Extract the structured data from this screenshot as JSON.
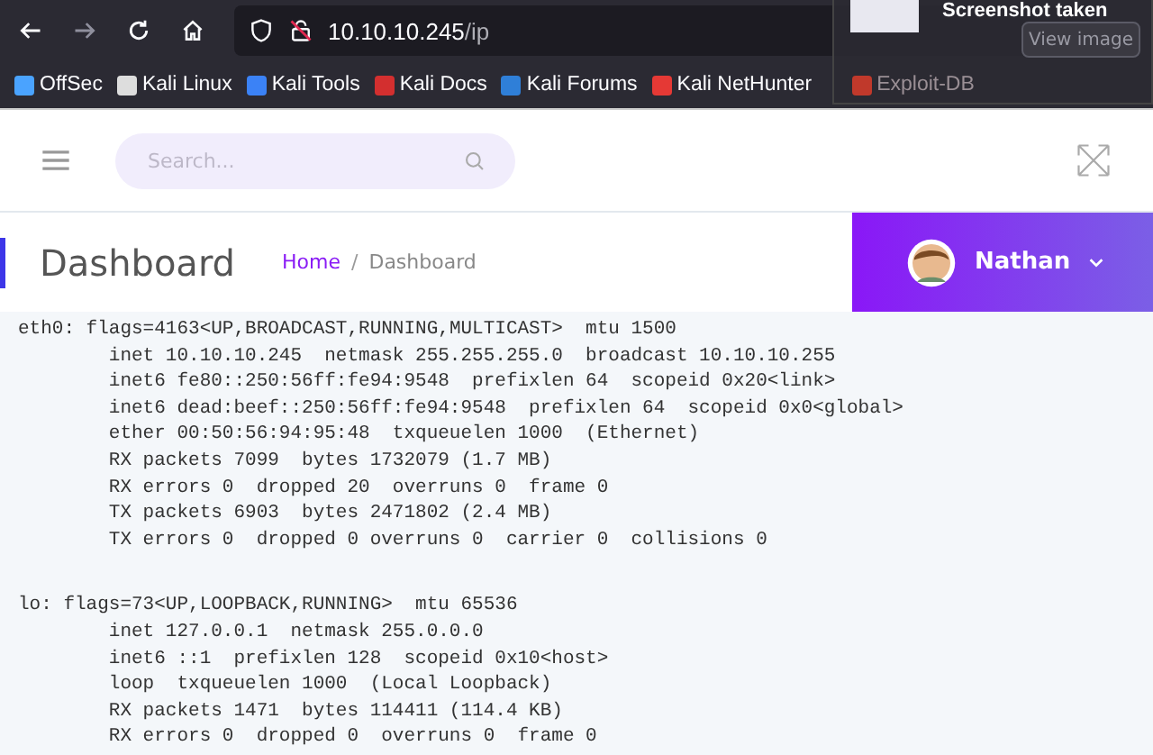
{
  "browser": {
    "address": {
      "host": "10.10.10.245",
      "path": "/ip"
    },
    "bookmarks": [
      "OffSec",
      "Kali Linux",
      "Kali Tools",
      "Kali Docs",
      "Kali Forums",
      "Kali NetHunter",
      "Exploit-DB"
    ],
    "notification": {
      "title": "Screenshot taken",
      "button": "View image"
    }
  },
  "header": {
    "search": {
      "placeholder": "Search..."
    }
  },
  "page_title": "Dashboard",
  "breadcrumb_separator": "/",
  "breadcrumb": [
    {
      "label": "Home",
      "selected": false
    },
    {
      "label": "Dashboard",
      "selected": true
    }
  ],
  "user": {
    "name": "Nathan"
  },
  "output": [
    {
      "header": "eth0: flags=4163<UP,BROADCAST,RUNNING,MULTICAST>  mtu 1500",
      "lines": [
        "inet 10.10.10.245  netmask 255.255.255.0  broadcast 10.10.10.255",
        "inet6 fe80::250:56ff:fe94:9548  prefixlen 64  scopeid 0x20<link>",
        "inet6 dead:beef::250:56ff:fe94:9548  prefixlen 64  scopeid 0x0<global>",
        "ether 00:50:56:94:95:48  txqueuelen 1000  (Ethernet)",
        "RX packets 7099  bytes 1732079 (1.7 MB)",
        "RX errors 0  dropped 20  overruns 0  frame 0",
        "TX packets 6903  bytes 2471802 (2.4 MB)",
        "TX errors 0  dropped 0 overruns 0  carrier 0  collisions 0"
      ]
    },
    {
      "header": "lo: flags=73<UP,LOOPBACK,RUNNING>  mtu 65536",
      "lines": [
        "inet 127.0.0.1  netmask 255.0.0.0",
        "inet6 ::1  prefixlen 128  scopeid 0x10<host>",
        "loop  txqueuelen 1000  (Local Loopback)",
        "RX packets 1471  bytes 114411 (114.4 KB)",
        "RX errors 0  dropped 0  overruns 0  frame 0"
      ]
    }
  ]
}
